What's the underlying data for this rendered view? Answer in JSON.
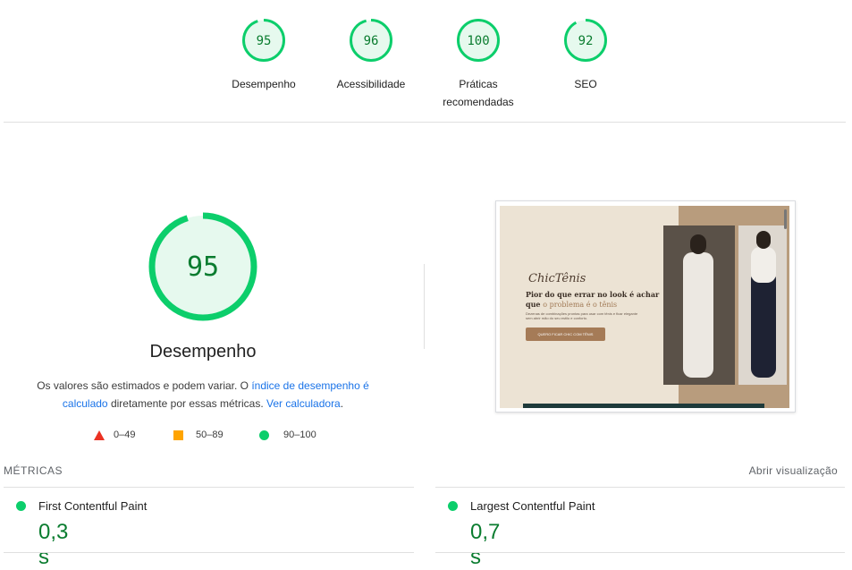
{
  "scores": [
    {
      "value": "95",
      "label": "Desempenho",
      "fraction": 0.95
    },
    {
      "value": "96",
      "label": "Acessibilidade",
      "fraction": 0.96
    },
    {
      "value": "100",
      "label": "Práticas recomendadas",
      "fraction": 1.0
    },
    {
      "value": "92",
      "label": "SEO",
      "fraction": 0.92
    }
  ],
  "performance": {
    "value": "95",
    "fraction": 0.95,
    "title": "Desempenho",
    "desc_prefix": "Os valores são estimados e podem variar. O ",
    "desc_link": "índice de desempenho é calculado",
    "desc_middle": " diretamente por essas métricas. ",
    "desc_calc_link": "Ver calculadora",
    "desc_end": "."
  },
  "legend": {
    "fail": "0–49",
    "average": "50–89",
    "pass": "90–100"
  },
  "preview": {
    "brand": "ChicTênis",
    "headline_a": "Pior do que errar no look é achar que ",
    "headline_b": "o problema é o tênis",
    "body": "Dezenas de combinações prontas para usar com tênis e ficar elegante sem abrir mão do seu estilo e conforto.",
    "cta": "QUERO FICAR CHIC COM TÊNIS"
  },
  "metrics": {
    "title": "MÉTRICAS",
    "expand_link": "Abrir visualização",
    "items": [
      {
        "name": "First Contentful Paint",
        "value": "0,3 s"
      },
      {
        "name": "Largest Contentful Paint",
        "value": "0,7 s"
      }
    ]
  },
  "colors": {
    "pass": "#0cce6b",
    "pass_text": "#0a7c2f",
    "pass_fill": "#e6f9ee",
    "average": "#ffa400",
    "fail": "#eb3223",
    "link": "#1a73e8"
  }
}
